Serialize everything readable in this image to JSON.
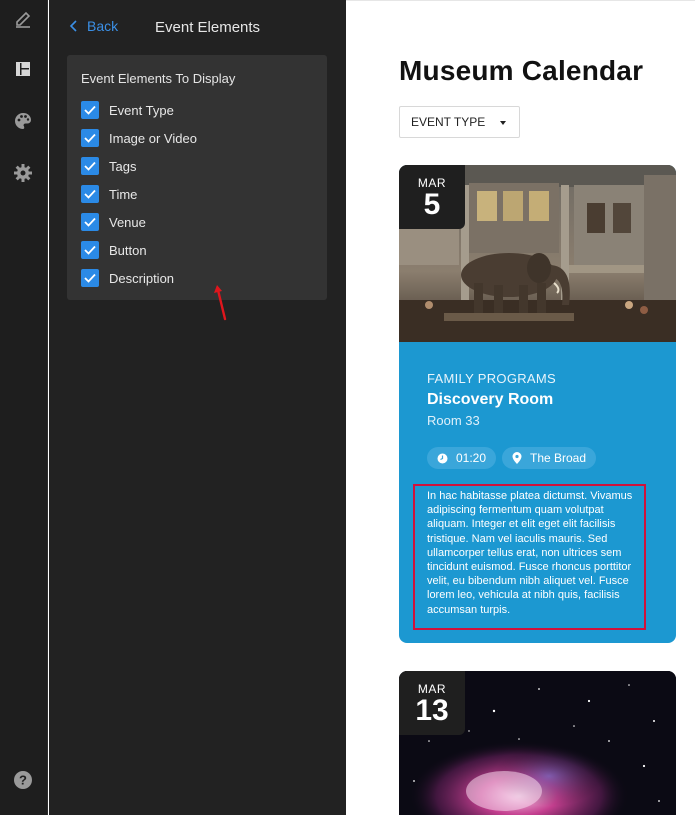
{
  "panel": {
    "back_label": "Back",
    "title": "Event Elements",
    "card_title": "Event Elements To Display",
    "checkboxes": [
      {
        "label": "Event Type",
        "checked": true
      },
      {
        "label": "Image or Video",
        "checked": true
      },
      {
        "label": "Tags",
        "checked": true
      },
      {
        "label": "Time",
        "checked": true
      },
      {
        "label": "Venue",
        "checked": true
      },
      {
        "label": "Button",
        "checked": true
      },
      {
        "label": "Description",
        "checked": true
      }
    ]
  },
  "rail": {
    "icons": [
      "pencil-icon",
      "layout-icon",
      "palette-icon",
      "gear-icon",
      "help-icon"
    ]
  },
  "preview": {
    "page_title": "Museum Calendar",
    "filter_label": "EVENT TYPE",
    "events": [
      {
        "month": "MAR",
        "day": "5",
        "event_type": "FAMILY PROGRAMS",
        "title": "Discovery Room",
        "room": "Room 33",
        "time": "01:20",
        "venue": "The Broad",
        "description": "In hac habitasse platea dictumst. Vivamus adipiscing fermentum quam volutpat aliquam. Integer et elit eget elit facilisis tristique. Nam vel iaculis mauris. Sed ullamcorper tellus erat, non ultrices sem tincidunt euismod. Fusce rhoncus porttitor velit, eu bibendum nibh aliquet vel. Fusce lorem leo, vehicula at nibh quis, facilisis accumsan turpis."
      },
      {
        "month": "MAR",
        "day": "13"
      }
    ]
  },
  "colors": {
    "accent_blue": "#2b8ae6",
    "card_blue": "#1c98d1",
    "highlight_red": "#d0123c"
  }
}
